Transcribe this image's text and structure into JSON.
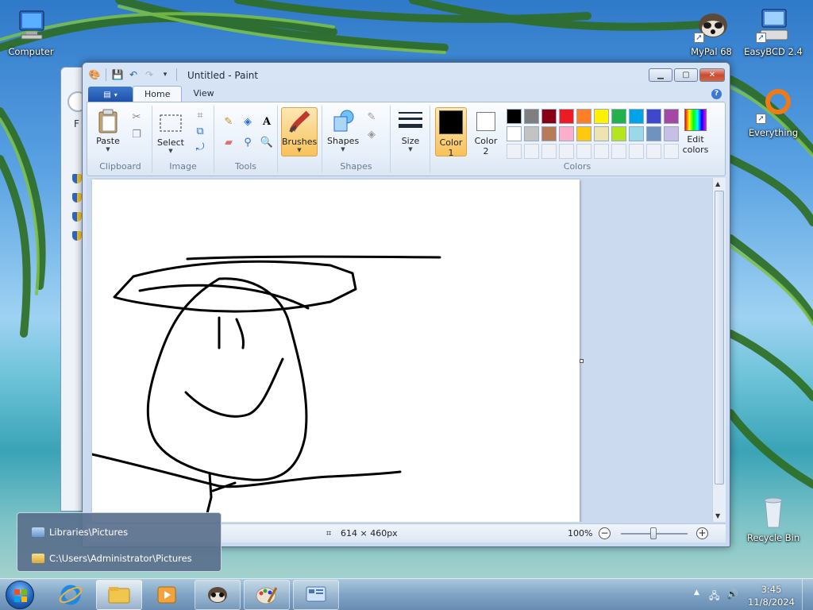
{
  "desktop": {
    "icons": [
      {
        "label": "Computer",
        "icon": "computer-icon"
      },
      {
        "label": "MyPal 68",
        "icon": "mypal-icon"
      },
      {
        "label": "EasyBCD 2.4",
        "icon": "easybcd-icon"
      },
      {
        "label": "Everything",
        "icon": "everything-icon"
      },
      {
        "label": "Recycle Bin",
        "icon": "recycle-bin-icon"
      }
    ]
  },
  "background_window": {
    "letter": "F"
  },
  "paint": {
    "title": "Untitled - Paint",
    "tabs": {
      "file": "▤",
      "home": "Home",
      "view": "View"
    },
    "help": "?",
    "clipboard": {
      "paste": "Paste",
      "group": "Clipboard"
    },
    "image": {
      "select": "Select",
      "group": "Image"
    },
    "tools": {
      "text_tool": "A",
      "group": "Tools"
    },
    "brushes": {
      "label": "Brushes"
    },
    "shapes": {
      "label": "Shapes",
      "group": "Shapes"
    },
    "size": {
      "label": "Size"
    },
    "color1": {
      "label": "Color",
      "num": "1"
    },
    "color2": {
      "label": "Color",
      "num": "2"
    },
    "edit_colors": {
      "line1": "Edit",
      "line2": "colors"
    },
    "colors_group": "Colors",
    "palette_row1": [
      "#000000",
      "#7f7f7f",
      "#880015",
      "#ed1c24",
      "#ff7f27",
      "#fff200",
      "#22b14c",
      "#00a2e8",
      "#3f48cc",
      "#a349a4"
    ],
    "palette_row2": [
      "#ffffff",
      "#c3c3c3",
      "#b97a57",
      "#ffaec9",
      "#ffc90e",
      "#efe4b0",
      "#b5e61d",
      "#99d9ea",
      "#7092be",
      "#c8bfe7"
    ],
    "status": {
      "size": "614 × 460px",
      "zoom": "100%"
    }
  },
  "jump_list": {
    "items": [
      "Libraries\\Pictures",
      "C:\\Users\\Administrator\\Pictures"
    ]
  },
  "taskbar": {
    "clock_time": "3:45",
    "clock_date": "11/8/2024"
  },
  "colors": {
    "accent": "#1d5fb8",
    "brush_active": "#f7c25b"
  }
}
